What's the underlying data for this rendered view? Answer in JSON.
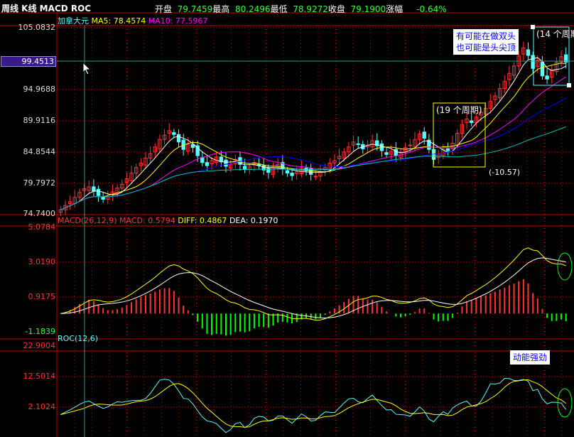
{
  "header": {
    "title": "周线 K线 MACD ROC",
    "open_label": "开盘",
    "open": "79.7459",
    "high_label": "最高",
    "high": "80.2496",
    "low_label": "最低",
    "low": "78.9272",
    "close_label": "收盘",
    "close": "79.1900",
    "change_label": "涨幅",
    "change": "-0.64%"
  },
  "price_panel": {
    "name": "加拿大元",
    "ma5": "MA5: 78.4574",
    "ma10": "MA10: 77.5967",
    "axis": [
      "105.0832",
      "94.9688",
      "89.9116",
      "84.8544",
      "79.7972",
      "74.7400"
    ],
    "cursor_value": "99.4513"
  },
  "macd_panel": {
    "label": "MACD(26,12,9)",
    "macd": "MACD: 0.5794",
    "diff": "DIFF: 0.4867",
    "dea": "DEA: 0.1970",
    "axis": [
      "5.0784",
      "3.0190",
      "0.9175",
      "-1.1839"
    ]
  },
  "roc_panel": {
    "label": "ROC(12,6)",
    "axis": [
      "22.9004",
      "12.5014",
      "2.1024"
    ]
  },
  "annotations": {
    "box1": "(19 个周期)",
    "box1_value": "(-10.57)",
    "box2": "(14 个周期",
    "note1_line1": "有可能在做双头",
    "note1_line2": "也可能是头尖顶",
    "note2": "动能强劲"
  },
  "colors": {
    "up": "#ff3232",
    "down": "#54ffff",
    "ma5": "#ffffff",
    "ma10": "#ffff00",
    "ma20": "#ff00ff",
    "ma30": "#0000ff",
    "ma60": "#00c0c0",
    "grid": "#c00000"
  },
  "chart_data": {
    "type": "candlestick",
    "period": "weekly",
    "ylim": [
      74.74,
      105.0832
    ],
    "macd_ylim": [
      -1.1839,
      5.0784
    ],
    "roc_ylim": [
      -8.05,
      22.9004
    ],
    "closes": [
      75.5,
      76.2,
      76.8,
      77.5,
      78.3,
      78.9,
      79.2,
      78.5,
      77.8,
      77.2,
      77.6,
      78.4,
      79.0,
      79.6,
      80.5,
      81.4,
      82.3,
      83.0,
      83.8,
      84.5,
      85.6,
      86.8,
      87.5,
      88.2,
      87.6,
      86.4,
      85.2,
      86.0,
      85.5,
      84.2,
      83.1,
      82.6,
      83.4,
      84.0,
      83.2,
      82.5,
      82.9,
      83.6,
      82.8,
      82.0,
      82.4,
      83.1,
      82.6,
      81.9,
      81.5,
      82.3,
      82.8,
      82.1,
      81.4,
      81.0,
      81.6,
      82.2,
      81.8,
      81.2,
      80.9,
      81.6,
      82.3,
      83.0,
      83.4,
      84.1,
      84.8,
      85.6,
      86.4,
      86.0,
      85.3,
      85.9,
      86.6,
      85.8,
      85.0,
      84.4,
      84.9,
      84.2,
      84.8,
      85.5,
      85.9,
      86.8,
      87.7,
      87.0,
      85.2,
      83.6,
      84.5,
      85.3,
      85.0,
      86.2,
      87.8,
      89.2,
      90.1,
      89.5,
      90.4,
      91.2,
      91.8,
      92.9,
      93.8,
      95.0,
      96.1,
      97.4,
      98.6,
      100.2,
      101.5,
      100.3,
      98.2,
      99.5,
      97.0,
      96.5,
      98.0,
      99.2,
      100.1,
      99.2
    ]
  }
}
